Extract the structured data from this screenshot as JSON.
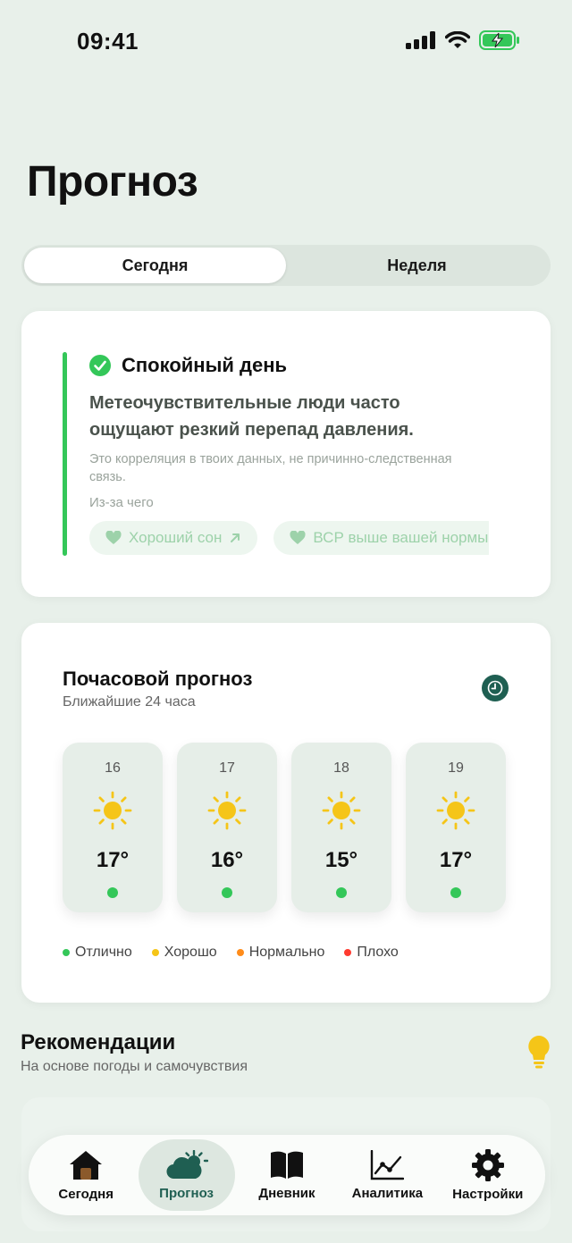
{
  "status": {
    "time": "09:41"
  },
  "page": {
    "title": "Прогноз"
  },
  "segments": [
    {
      "label": "Сегодня",
      "active": true
    },
    {
      "label": "Неделя",
      "active": false
    }
  ],
  "insight": {
    "title": "Спокойный день",
    "text": "Метеочувствительные люди часто ощущают резкий перепад давления.",
    "note": "Это корреляция в твоих данных, не причинно-следственная связь.",
    "cause_label": "Из-за чего",
    "chips": [
      {
        "label": "Хороший сон",
        "icon": "heart-icon",
        "trend": "arrow-up-right-icon"
      },
      {
        "label": "ВСР выше вашей нормы",
        "icon": "heart-icon"
      }
    ]
  },
  "hourly": {
    "title": "Почасовой прогноз",
    "subtitle": "Ближайшие 24 часа",
    "hours": [
      {
        "hour": "16",
        "temp": "17°",
        "icon": "sun-icon",
        "status": "Отлично"
      },
      {
        "hour": "17",
        "temp": "16°",
        "icon": "sun-icon",
        "status": "Отлично"
      },
      {
        "hour": "18",
        "temp": "15°",
        "icon": "sun-icon",
        "status": "Отлично"
      },
      {
        "hour": "19",
        "temp": "17°",
        "icon": "sun-icon",
        "status": "Отлично"
      }
    ],
    "legend": [
      {
        "label": "Отлично",
        "color": "#34C759"
      },
      {
        "label": "Хорошо",
        "color": "#F5C518"
      },
      {
        "label": "Нормально",
        "color": "#FF8C1A"
      },
      {
        "label": "Плохо",
        "color": "#FF3B30"
      }
    ]
  },
  "recommendations": {
    "title": "Рекомендации",
    "subtitle": "На основе погоды и самочувствия"
  },
  "tabs": [
    {
      "label": "Сегодня",
      "icon": "home-icon",
      "active": false
    },
    {
      "label": "Прогноз",
      "icon": "weather-icon",
      "active": true
    },
    {
      "label": "Дневник",
      "icon": "book-icon",
      "active": false
    },
    {
      "label": "Аналитика",
      "icon": "chart-icon",
      "active": false
    },
    {
      "label": "Настройки",
      "icon": "gear-icon",
      "active": false
    }
  ],
  "colors": {
    "accent": "#1F5F52",
    "good": "#34C759",
    "background": "#E8F0EA"
  }
}
